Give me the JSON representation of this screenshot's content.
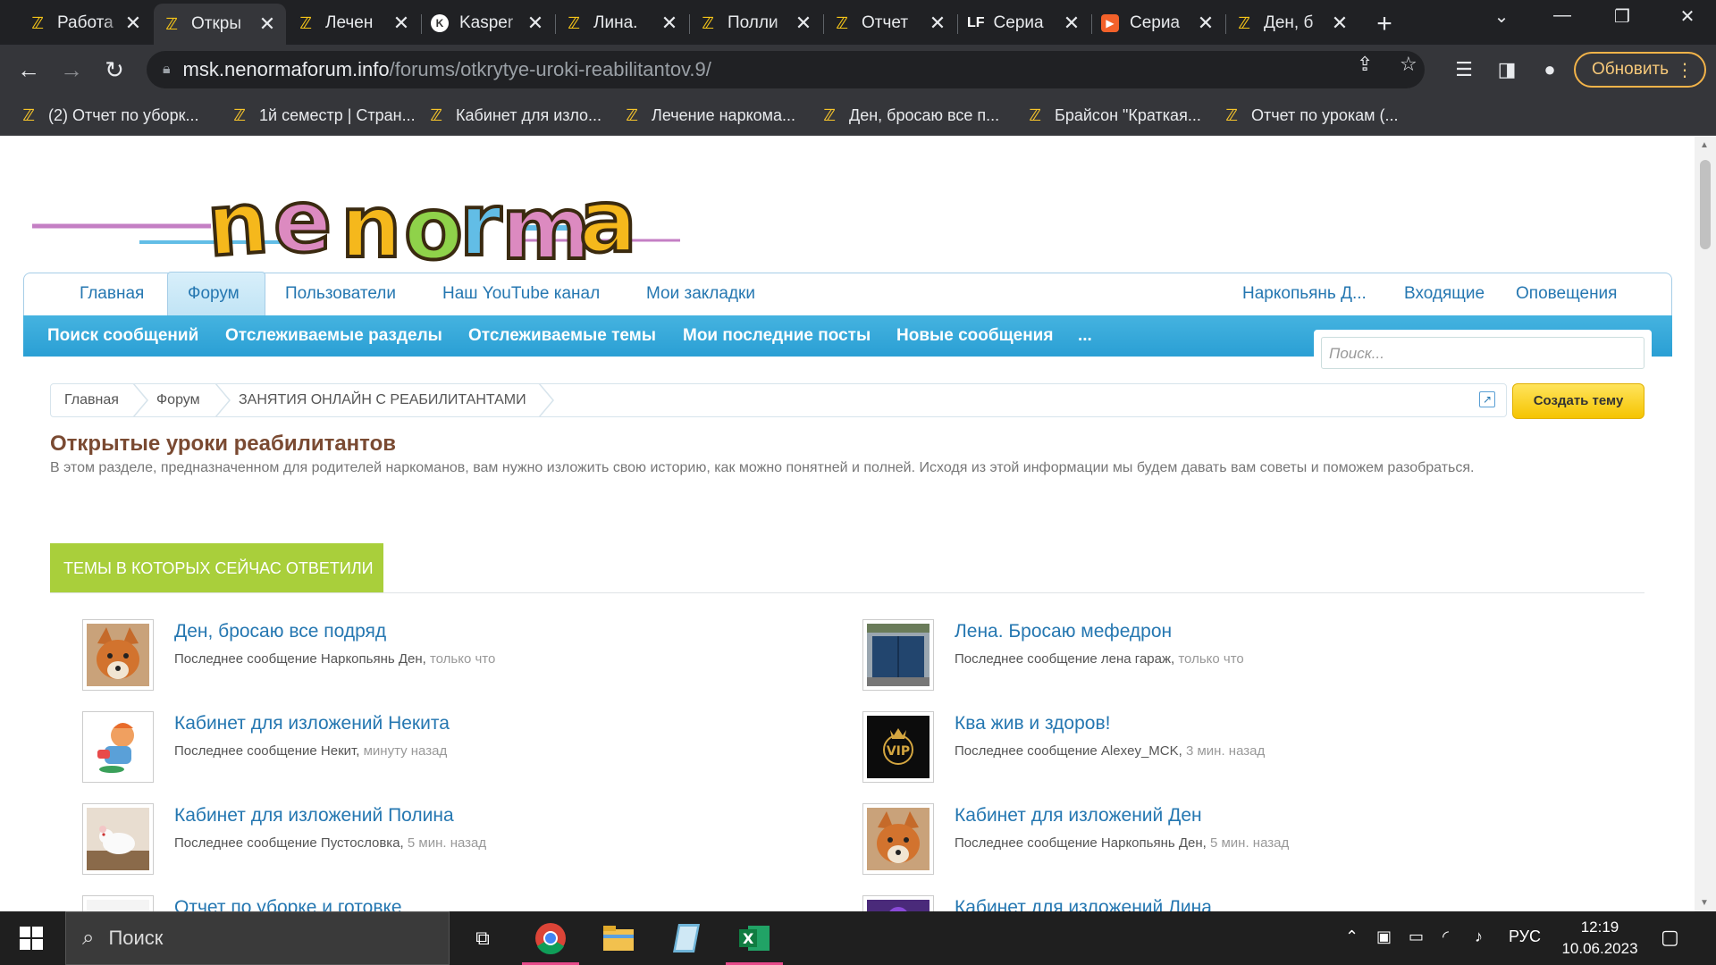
{
  "tabs": [
    {
      "title": "Работа",
      "icon": "yellow-logo-icon"
    },
    {
      "title": "Откры",
      "icon": "yellow-logo-icon",
      "active": true
    },
    {
      "title": "Лечен",
      "icon": "yellow-logo-icon"
    },
    {
      "title": "Kasper",
      "icon": "kaspersky-icon"
    },
    {
      "title": "Лина.",
      "icon": "yellow-logo-icon"
    },
    {
      "title": "Полли",
      "icon": "yellow-logo-icon"
    },
    {
      "title": "Отчет",
      "icon": "yellow-logo-icon"
    },
    {
      "title": "Сериа",
      "icon": "lf-icon",
      "icon_text": "LF"
    },
    {
      "title": "Сериа",
      "icon": "play-icon"
    },
    {
      "title": "Ден, б",
      "icon": "yellow-logo-icon"
    }
  ],
  "address": {
    "host": "msk.nenormaforum.info",
    "path": "/forums/otkrytye-uroki-reabilitantov.9/"
  },
  "update_label": "Обновить",
  "bookmarks": [
    "(2) Отчет по уборк...",
    "1й семестр | Стран...",
    "Кабинет для изло...",
    "Лечение наркома...",
    "Ден, бросаю все п...",
    "Брайсон \"Краткая...",
    "Отчет по урокам (..."
  ],
  "nav_primary": [
    "Главная",
    "Форум",
    "Пользователи",
    "Наш YouTube канал",
    "Мои закладки"
  ],
  "nav_user": [
    "Наркопьянь Д...",
    "Входящие",
    "Оповещения"
  ],
  "nav_secondary": [
    "Поиск сообщений",
    "Отслеживаемые разделы",
    "Отслеживаемые темы",
    "Мои последние посты",
    "Новые сообщения",
    "..."
  ],
  "search_placeholder": "Поиск...",
  "breadcrumbs": [
    "Главная",
    "Форум",
    "ЗАНЯТИЯ ОНЛАЙН С РЕАБИЛИТАНТАМИ"
  ],
  "create_label": "Создать тему",
  "page_title": "Открытые уроки реабилитантов",
  "page_desc": "В этом разделе, предназначенном для родителей наркоманов, вам нужно изложить свою историю, как можно понятней и полней. Исходя из этой информации мы будем давать вам советы и поможем разобраться.",
  "section_title": "ТЕМЫ В КОТОРЫХ СЕЙЧАС ОТВЕТИЛИ",
  "last_prefix": "Последнее сообщение",
  "threads_left": [
    {
      "title": "Ден, бросаю все подряд",
      "author": "Наркопьянь Ден",
      "time": "только что",
      "avatar": "fox"
    },
    {
      "title": "Кабинет для изложений Некита",
      "author": "Некит",
      "time": "минуту назад",
      "avatar": "cartoon"
    },
    {
      "title": "Кабинет для изложений Полина",
      "author": "Пустословка",
      "time": "5 мин. назад",
      "avatar": "rat"
    },
    {
      "title": "Отчет по уборке и готовке",
      "author": "",
      "time": "",
      "avatar": "bird"
    }
  ],
  "threads_right": [
    {
      "title": "Лена. Бросаю мефедрон",
      "author": "лена гараж",
      "time": "только что",
      "avatar": "garage"
    },
    {
      "title": "Ква жив и здоров!",
      "author": "Alexey_MCK",
      "time": "3 мин. назад",
      "avatar": "vip",
      "avatar_text": "VIP"
    },
    {
      "title": "Кабинет для изложений Ден",
      "author": "Наркопьянь Ден",
      "time": "5 мин. назад",
      "avatar": "fox"
    },
    {
      "title": "Кабинет для изложений Лина",
      "author": "",
      "time": "",
      "avatar": "purple"
    }
  ],
  "taskbar": {
    "search_label": "Поиск",
    "lang": "РУС",
    "time": "12:19",
    "date": "10.06.2023"
  },
  "colors": {
    "accent": "#2577b1",
    "green": "#a9cf3b",
    "title_brown": "#7a4a32",
    "yellow": "#f5c400"
  }
}
